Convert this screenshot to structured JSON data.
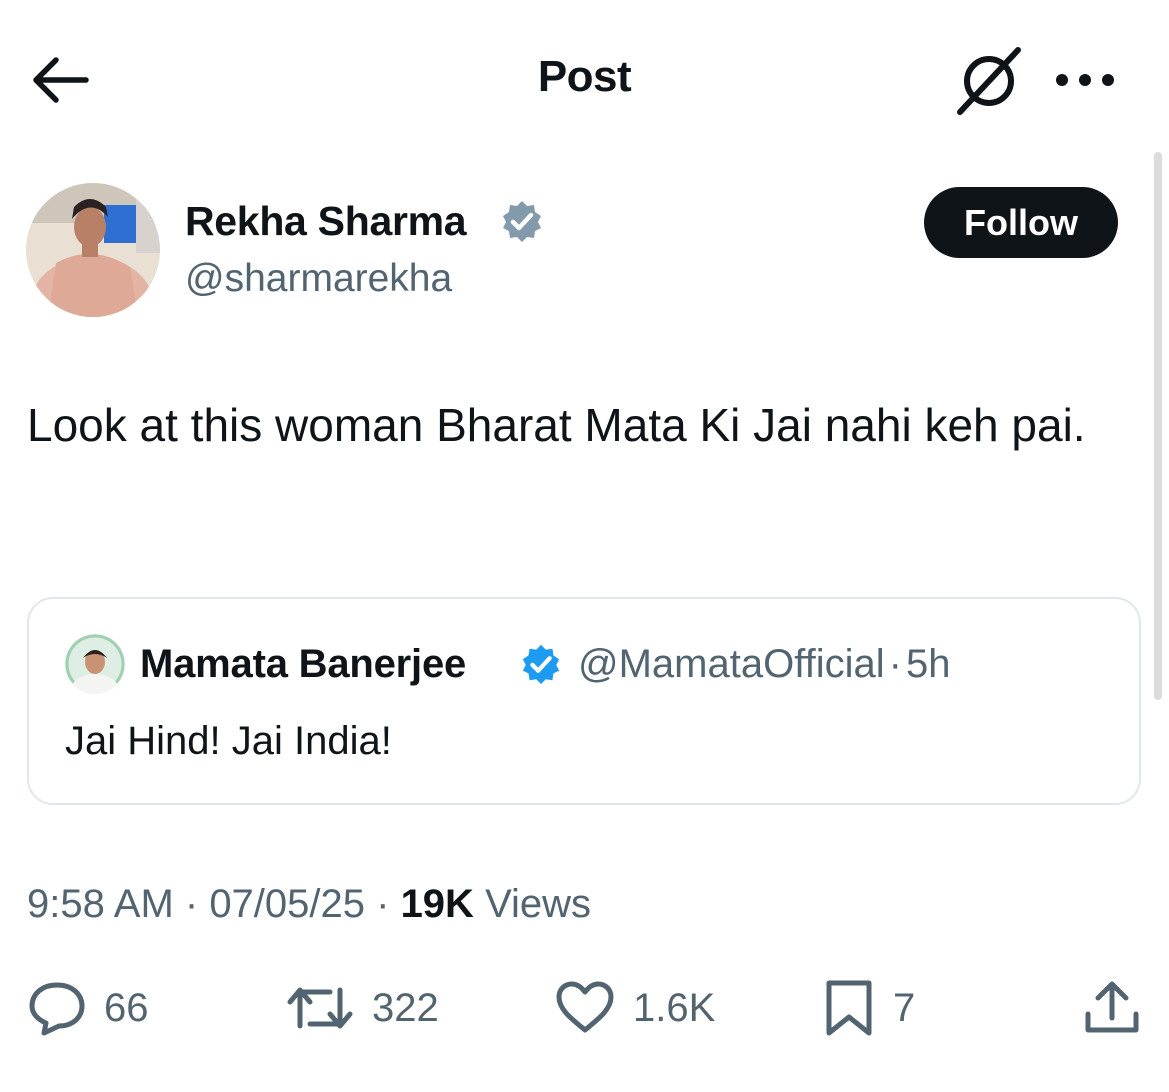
{
  "header": {
    "title": "Post"
  },
  "post": {
    "author": {
      "name": "Rekha Sharma",
      "handle": "@sharmarekha",
      "verified": true
    },
    "follow_label": "Follow",
    "text": "Look at this woman Bharat Mata Ki Jai nahi keh pai.",
    "quote": {
      "name": "Mamata Banerjee",
      "handle": "@MamataOfficial",
      "separator": "·",
      "age": "5h",
      "text": "Jai Hind! Jai India!"
    },
    "meta": {
      "time": "9:58 AM",
      "date": "07/05/25",
      "views_count": "19K",
      "views_label": "Views"
    },
    "actions": {
      "replies": "66",
      "reposts": "322",
      "likes": "1.6K",
      "bookmarks": "7"
    }
  },
  "colors": {
    "text_primary": "#0f1419",
    "text_secondary": "#536471",
    "verified_blue": "#1d9bf0",
    "verified_gray": "#829aab",
    "follow_bg": "#0f1419",
    "border": "#e1e8ed"
  },
  "icons": {
    "back": "arrow-left-icon",
    "grok": "grok-icon",
    "more": "more-horizontal-icon",
    "reply": "reply-icon",
    "repost": "repost-icon",
    "like": "heart-icon",
    "bookmark": "bookmark-icon",
    "share": "share-icon"
  }
}
